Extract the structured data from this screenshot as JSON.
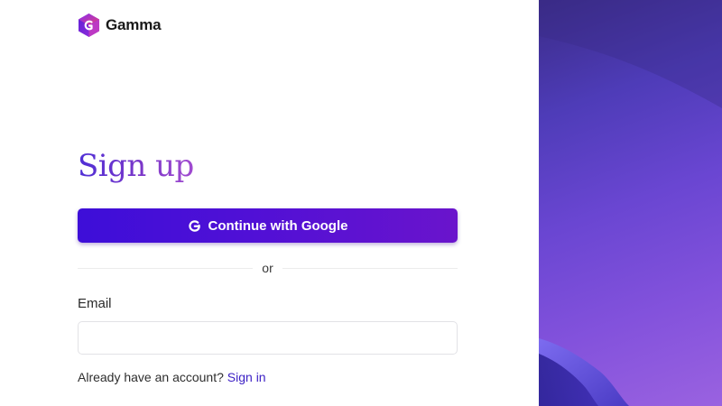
{
  "brand": {
    "name": "Gamma",
    "logo_icon": "gamma-cube-logo",
    "logo_colors": [
      "#7b2ff7",
      "#e0407f",
      "#4b1fd0"
    ]
  },
  "form": {
    "title": "Sign up",
    "google_button": {
      "label": "Continue with Google",
      "icon": "google-g-icon"
    },
    "divider_text": "or",
    "email": {
      "label": "Email",
      "value": "",
      "placeholder": ""
    },
    "signin_prompt": "Already have an account?",
    "signin_link": "Sign in"
  },
  "colors": {
    "accent": "#4a10d8",
    "link": "#3b1fc4",
    "side_panel": "#6a46d2"
  }
}
